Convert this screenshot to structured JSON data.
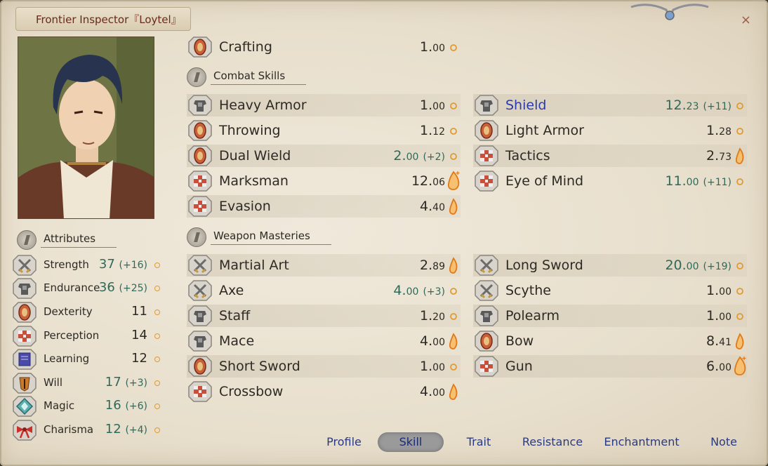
{
  "window": {
    "title": "Frontier Inspector『Loytel』",
    "close_label": "×"
  },
  "attributes_header": "Attributes",
  "attributes": [
    {
      "icon": "crossed-swords-icon",
      "name": "Strength",
      "value": "37",
      "bonus": "(+16)"
    },
    {
      "icon": "armor-icon",
      "name": "Endurance",
      "value": "36",
      "bonus": "(+25)"
    },
    {
      "icon": "hand-icon",
      "name": "Dexterity",
      "value": "11",
      "bonus": ""
    },
    {
      "icon": "eye-icon",
      "name": "Perception",
      "value": "14",
      "bonus": ""
    },
    {
      "icon": "book-icon",
      "name": "Learning",
      "value": "12",
      "bonus": ""
    },
    {
      "icon": "will-icon",
      "name": "Will",
      "value": "17",
      "bonus": "(+3)"
    },
    {
      "icon": "magic-icon",
      "name": "Magic",
      "value": "16",
      "bonus": "(+6)"
    },
    {
      "icon": "ribbon-icon",
      "name": "Charisma",
      "value": "12",
      "bonus": "(+4)"
    }
  ],
  "crafting": {
    "icon": "hand-icon",
    "name": "Crafting",
    "int": "1.",
    "dec": "00",
    "bonus": "",
    "potential": "low"
  },
  "combat_header": "Combat Skills",
  "combat_left": [
    {
      "icon": "armor-icon",
      "name": "Heavy Armor",
      "int": "1.",
      "dec": "00",
      "bonus": "",
      "potential": "low"
    },
    {
      "icon": "hand-icon",
      "name": "Throwing",
      "int": "1.",
      "dec": "12",
      "bonus": "",
      "potential": "low"
    },
    {
      "icon": "hand-icon",
      "name": "Dual Wield",
      "int": "2.",
      "dec": "00",
      "bonus": "(+2)",
      "potential": "low"
    },
    {
      "icon": "eye-icon",
      "name": "Marksman",
      "int": "12.",
      "dec": "06",
      "bonus": "",
      "potential": "high"
    },
    {
      "icon": "eye-icon",
      "name": "Evasion",
      "int": "4.",
      "dec": "40",
      "bonus": "",
      "potential": "mid"
    }
  ],
  "combat_right": [
    {
      "icon": "armor-icon",
      "name": "Shield",
      "int": "12.",
      "dec": "23",
      "bonus": "(+11)",
      "potential": "low",
      "highlight": true
    },
    {
      "icon": "hand-icon",
      "name": "Light Armor",
      "int": "1.",
      "dec": "28",
      "bonus": "",
      "potential": "low"
    },
    {
      "icon": "eye-icon",
      "name": "Tactics",
      "int": "2.",
      "dec": "73",
      "bonus": "",
      "potential": "mid"
    },
    {
      "icon": "eye-icon",
      "name": "Eye of Mind",
      "int": "11.",
      "dec": "00",
      "bonus": "(+11)",
      "potential": "low"
    }
  ],
  "weapon_header": "Weapon Masteries",
  "weapon_left": [
    {
      "icon": "crossed-swords-icon",
      "name": "Martial Art",
      "int": "2.",
      "dec": "89",
      "bonus": "",
      "potential": "mid"
    },
    {
      "icon": "crossed-swords-icon",
      "name": "Axe",
      "int": "4.",
      "dec": "00",
      "bonus": "(+3)",
      "potential": "low"
    },
    {
      "icon": "armor-icon",
      "name": "Staff",
      "int": "1.",
      "dec": "20",
      "bonus": "",
      "potential": "low"
    },
    {
      "icon": "armor-icon",
      "name": "Mace",
      "int": "4.",
      "dec": "00",
      "bonus": "",
      "potential": "mid"
    },
    {
      "icon": "hand-icon",
      "name": "Short Sword",
      "int": "1.",
      "dec": "00",
      "bonus": "",
      "potential": "low"
    },
    {
      "icon": "eye-icon",
      "name": "Crossbow",
      "int": "4.",
      "dec": "00",
      "bonus": "",
      "potential": "mid"
    }
  ],
  "weapon_right": [
    {
      "icon": "crossed-swords-icon",
      "name": "Long Sword",
      "int": "20.",
      "dec": "00",
      "bonus": "(+19)",
      "potential": "low"
    },
    {
      "icon": "crossed-swords-icon",
      "name": "Scythe",
      "int": "1.",
      "dec": "00",
      "bonus": "",
      "potential": "low"
    },
    {
      "icon": "armor-icon",
      "name": "Polearm",
      "int": "1.",
      "dec": "00",
      "bonus": "",
      "potential": "low"
    },
    {
      "icon": "hand-icon",
      "name": "Bow",
      "int": "8.",
      "dec": "41",
      "bonus": "",
      "potential": "mid"
    },
    {
      "icon": "eye-icon",
      "name": "Gun",
      "int": "6.",
      "dec": "00",
      "bonus": "",
      "potential": "high"
    }
  ],
  "tabs": [
    {
      "label": "Profile",
      "active": false
    },
    {
      "label": "Skill",
      "active": true
    },
    {
      "label": "Trait",
      "active": false
    },
    {
      "label": "Resistance",
      "active": false
    },
    {
      "label": "Enchantment",
      "active": false
    },
    {
      "label": "Note",
      "active": false
    }
  ],
  "colors": {
    "bonus": "#2e6a5a",
    "highlight": "#2a3ab0",
    "title": "#6a2a18",
    "tab": "#2a3a80"
  }
}
